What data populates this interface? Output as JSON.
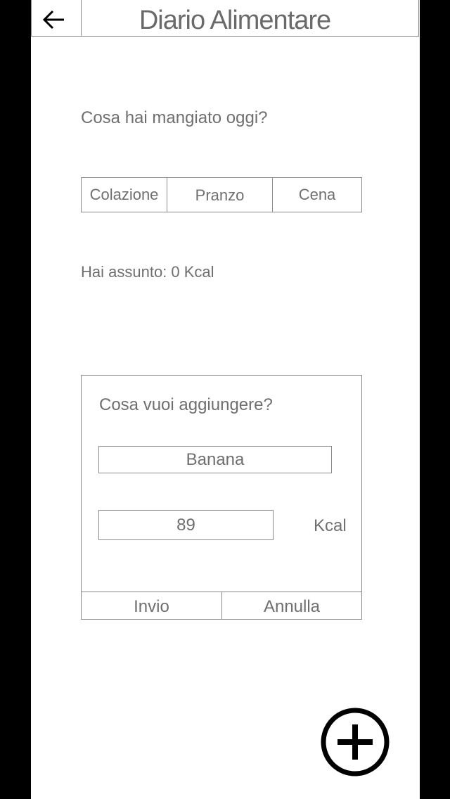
{
  "header": {
    "title": "Diario Alimentare",
    "back_icon": "arrow-left-icon"
  },
  "main": {
    "question": "Cosa hai mangiato oggi?",
    "tabs": [
      {
        "label": "Colazione"
      },
      {
        "label": "Pranzo"
      },
      {
        "label": "Cena"
      }
    ],
    "intake": "Hai assunto: 0 Kcal"
  },
  "dialog": {
    "title": "Cosa vuoi aggiungere?",
    "food_value": "Banana",
    "kcal_value": "89",
    "kcal_unit": "Kcal",
    "submit_label": "Invio",
    "cancel_label": "Annulla"
  },
  "fab": {
    "icon": "plus-circle-icon"
  }
}
